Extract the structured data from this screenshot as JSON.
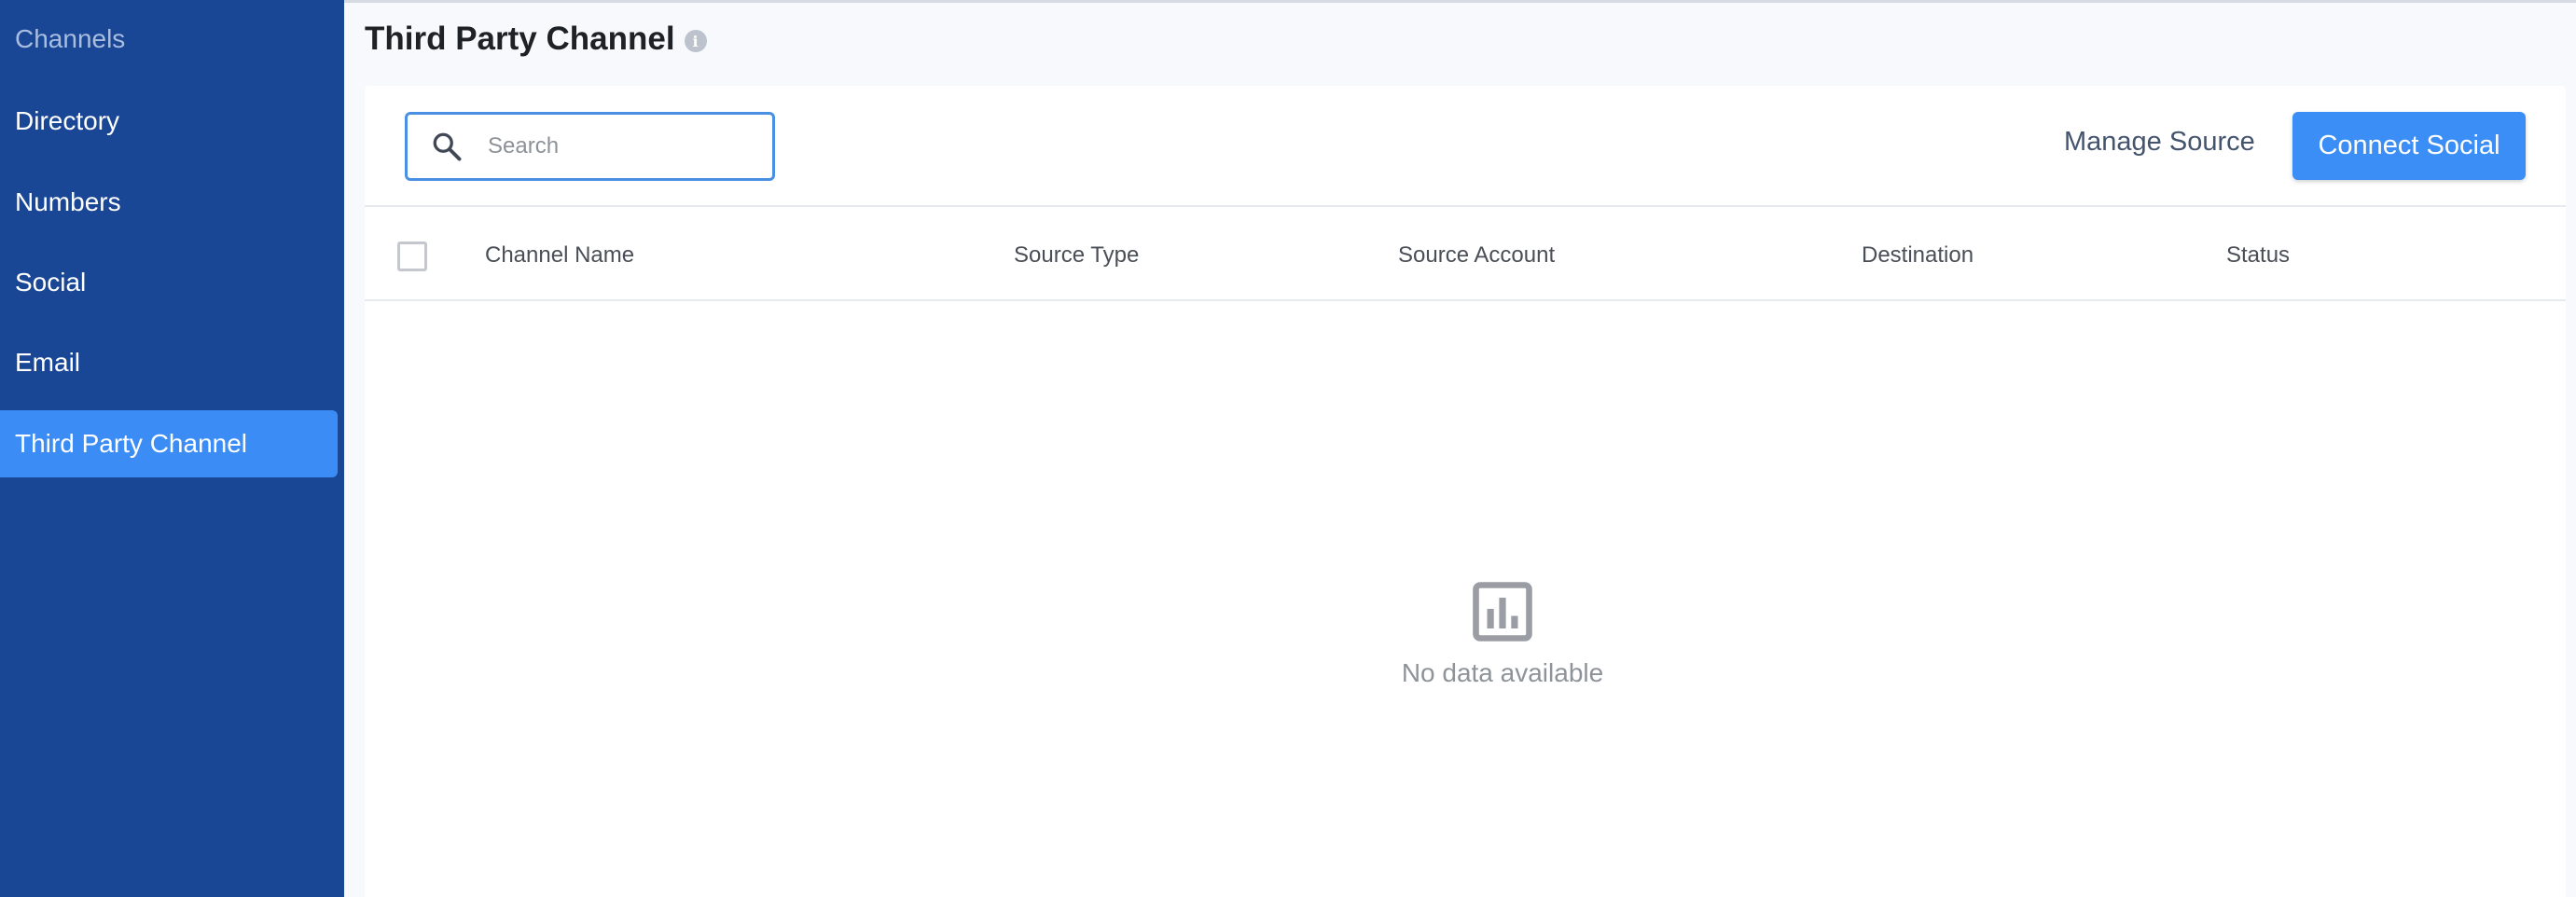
{
  "sidebar": {
    "heading": "Channels",
    "items": [
      {
        "label": "Directory",
        "active": false
      },
      {
        "label": "Numbers",
        "active": false
      },
      {
        "label": "Social",
        "active": false
      },
      {
        "label": "Email",
        "active": false
      },
      {
        "label": "Third Party Channel",
        "active": true
      }
    ]
  },
  "page": {
    "title": "Third Party Channel",
    "info_icon": "info-icon"
  },
  "toolbar": {
    "search_placeholder": "Search",
    "search_value": "",
    "manage_source_label": "Manage Source",
    "connect_social_label": "Connect Social"
  },
  "table": {
    "columns": [
      "Channel Name",
      "Source Type",
      "Source Account",
      "Destination",
      "Status"
    ],
    "rows": []
  },
  "empty_state": {
    "icon": "bar-chart-icon",
    "text": "No data available"
  },
  "colors": {
    "sidebar_bg": "#1a4795",
    "sidebar_active": "#3b8cf5",
    "primary_button": "#3a8ef5",
    "search_border": "#4a90e2"
  }
}
